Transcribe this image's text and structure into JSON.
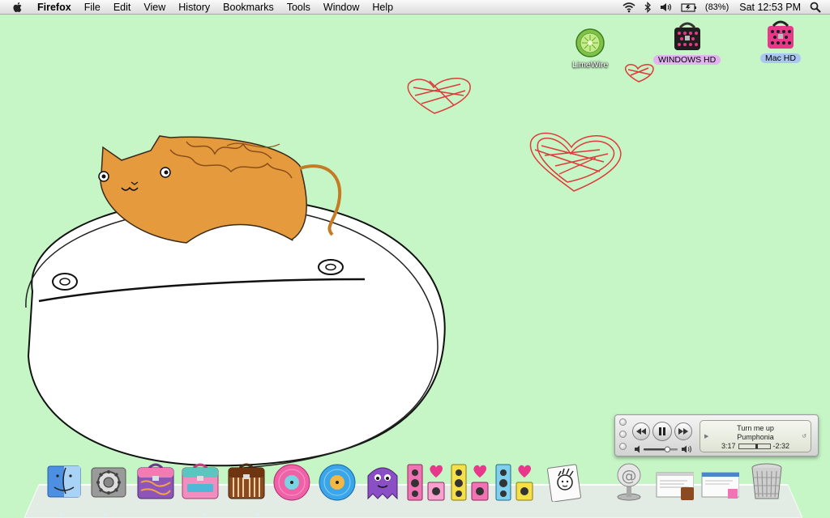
{
  "menubar": {
    "app_name": "Firefox",
    "menus": [
      "File",
      "Edit",
      "View",
      "History",
      "Bookmarks",
      "Tools",
      "Window",
      "Help"
    ],
    "battery_text": "(83%)",
    "clock": "Sat 12:53 PM",
    "icons": [
      "apple-icon",
      "wifi-icon",
      "bluetooth-icon",
      "volume-icon",
      "battery-icon",
      "spotlight-icon"
    ]
  },
  "desktop": {
    "icons": [
      {
        "label": "LimeWire",
        "icon": "limewire-icon"
      },
      {
        "label": "WINDOWS HD",
        "icon": "hard-drive-icon"
      },
      {
        "label": "Mac HD",
        "icon": "hard-drive-icon"
      }
    ],
    "background_color": "#c6f6c6"
  },
  "itunes": {
    "song": "Turn me up",
    "artist": "Pumphonia",
    "elapsed": "3:17",
    "remaining": "-2:32",
    "progress": 0.56,
    "volume": 0.7,
    "buttons": [
      "previous-icon",
      "pause-icon",
      "next-icon"
    ]
  },
  "dock": {
    "items": [
      "finder",
      "system-preferences",
      "pink-lunchbox",
      "teal-lunchbox",
      "brown-lunchbox",
      "pink-record",
      "blue-record",
      "purple-monster",
      "speakers-pink",
      "speakers-yellow",
      "speakers-blue",
      "address-book",
      "mail",
      "minimized-window-1",
      "minimized-window-2",
      "trash"
    ]
  }
}
